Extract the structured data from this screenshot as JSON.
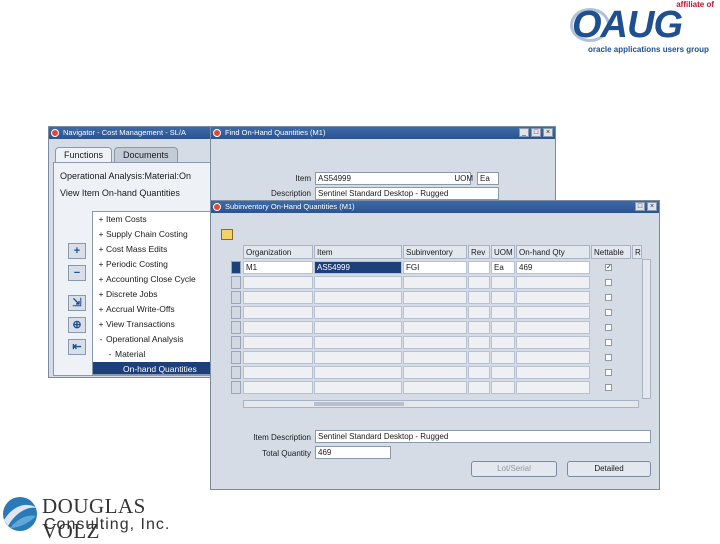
{
  "branding": {
    "oaug_affiliate": "affiliate of",
    "oaug_word": "OAUG",
    "oaug_tagline": "oracle applications users group",
    "company_line1": "DOUGLAS VOLZ",
    "company_line2": "Consulting, Inc."
  },
  "navigator": {
    "title": "Navigator - Cost Management - SL/A",
    "tabs": [
      "Functions",
      "Documents"
    ],
    "path_line1": "Operational Analysis:Material:On",
    "path_line2": "View Item On-hand Quantities",
    "tree": [
      {
        "sym": "+",
        "label": "Item Costs"
      },
      {
        "sym": "+",
        "label": "Supply Chain Costing"
      },
      {
        "sym": "+",
        "label": "Cost Mass Edits"
      },
      {
        "sym": "+",
        "label": "Periodic Costing"
      },
      {
        "sym": "+",
        "label": "Accounting Close Cycle"
      },
      {
        "sym": "+",
        "label": "Discrete Jobs"
      },
      {
        "sym": "+",
        "label": "Accrual Write-Offs"
      },
      {
        "sym": "+",
        "label": "View Transactions"
      },
      {
        "sym": "-",
        "label": "Operational Analysis"
      },
      {
        "sym": "-",
        "label": "Material"
      },
      {
        "sym": "",
        "label": "On-hand Quantities"
      }
    ]
  },
  "find_window": {
    "title": "Find On-Hand Quantities (M1)",
    "item_label": "Item",
    "item_value": "AS54999",
    "uom_label": "UOM",
    "uom_value": "Ea",
    "desc_label": "Description",
    "desc_value": "Sentinel Standard Desktop - Rugged"
  },
  "sub_window": {
    "title": "Subinventory On-Hand Quantities (M1)",
    "columns": [
      "Organization",
      "Item",
      "Subinventory",
      "Rev",
      "UOM",
      "On-hand Qty",
      "Nettable",
      "R"
    ],
    "first_row": {
      "org": "M1",
      "item": "AS54999",
      "subinv": "FGI",
      "rev": "",
      "uom": "Ea",
      "qty": "469"
    },
    "item_desc_label": "Item Description",
    "item_desc_value": "Sentinel Standard Desktop - Rugged",
    "total_qty_label": "Total Quantity",
    "total_qty_value": "469",
    "lot_serial_button": "Lot/Serial",
    "detailed_button": "Detailed"
  }
}
